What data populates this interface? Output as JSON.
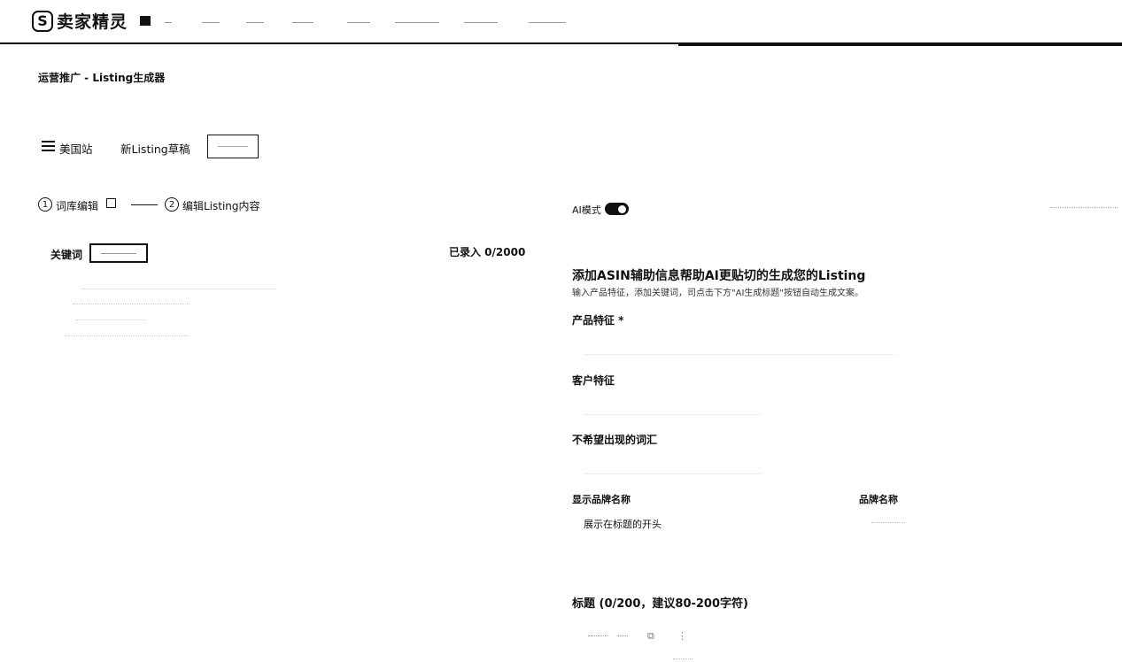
{
  "app": {
    "logo_letter": "S",
    "logo_text": "卖家精灵"
  },
  "breadcrumb": "运营推广 - Listing生成器",
  "tabs": {
    "site": "美国站",
    "draft": "新Listing草稿"
  },
  "steps": {
    "step1_num": "1",
    "step1_label": "词库编辑",
    "step2_num": "2",
    "step2_label": "编辑Listing内容"
  },
  "keywords": {
    "label": "关键词",
    "count": "已录入 0/2000"
  },
  "panel": {
    "ai_mode": "AI模式",
    "heading": "添加ASIN辅助信息帮助AI更贴切的生成您的Listing",
    "subheading": "输入产品特征，添加关键词，司点击下方\"AI生成标题\"按钮自动生成文案。",
    "product_features": "产品特征 *",
    "customer_features": "客户特征",
    "unwanted_words": "不希望出现的词汇",
    "show_brand": "显示品牌名称",
    "brand_name": "品牌名称",
    "brand_position": "展示在标题的开头",
    "title_label": "标题 (0/200，建议80-200字符)"
  },
  "colors": {
    "primary": "#111111",
    "background": "#ffffff"
  }
}
